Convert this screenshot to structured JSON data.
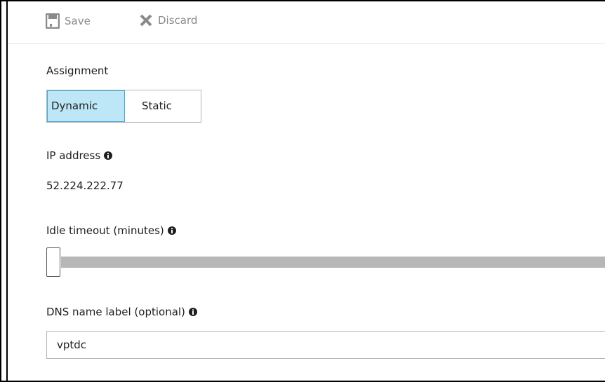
{
  "toolbar": {
    "save_label": "Save",
    "save_icon": "floppy-disk-icon",
    "discard_label": "Discard",
    "discard_icon": "close-x-icon",
    "disabled_color": "#8a8a8a"
  },
  "assignment": {
    "label": "Assignment",
    "options": [
      "Dynamic",
      "Static"
    ],
    "selected": "Dynamic",
    "selected_color": "#bde6f6"
  },
  "ip_address": {
    "label": "IP address",
    "value": "52.224.222.77",
    "info_icon": "info-circle-icon"
  },
  "idle_timeout": {
    "label": "Idle timeout (minutes)",
    "info_icon": "info-circle-icon",
    "slider_position": 0
  },
  "dns_label": {
    "label": "DNS name label (optional)",
    "info_icon": "info-circle-icon",
    "value": "vptdc"
  }
}
